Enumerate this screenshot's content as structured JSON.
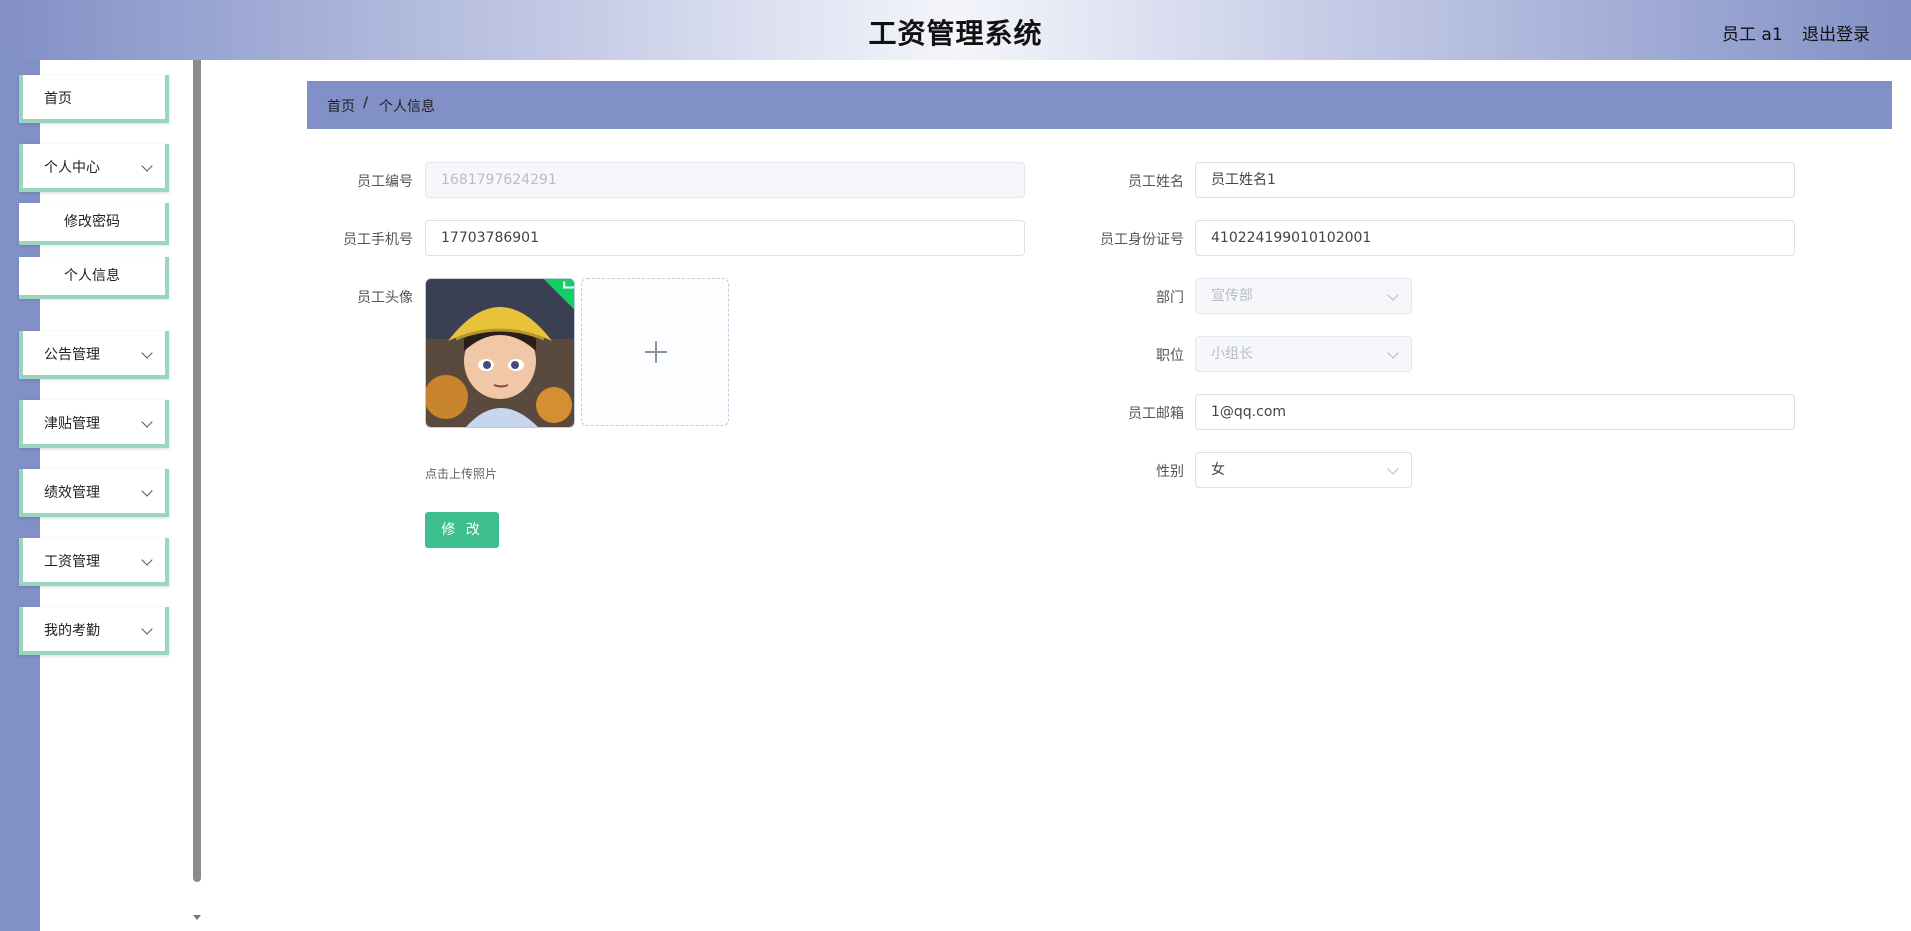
{
  "header": {
    "title": "工资管理系统",
    "user": "员工 a1",
    "logout": "退出登录"
  },
  "sidebar": {
    "items": [
      {
        "label": "首页"
      },
      {
        "label": "个人中心",
        "sub": [
          "修改密码",
          "个人信息"
        ]
      },
      {
        "label": "公告管理"
      },
      {
        "label": "津贴管理"
      },
      {
        "label": "绩效管理"
      },
      {
        "label": "工资管理"
      },
      {
        "label": "我的考勤"
      }
    ]
  },
  "breadcrumb": {
    "home": "首页",
    "separator": "/",
    "current": "个人信息"
  },
  "form": {
    "emp_no": {
      "label": "员工编号",
      "value": "1681797624291"
    },
    "emp_name": {
      "label": "员工姓名",
      "value": "员工姓名1"
    },
    "phone": {
      "label": "员工手机号",
      "value": "17703786901"
    },
    "id_card": {
      "label": "员工身份证号",
      "value": "410224199010102001"
    },
    "avatar": {
      "label": "员工头像",
      "tip": "点击上传照片"
    },
    "department": {
      "label": "部门",
      "value": "宣传部"
    },
    "position": {
      "label": "职位",
      "value": "小组长"
    },
    "email": {
      "label": "员工邮箱",
      "value": "1@qq.com"
    },
    "gender": {
      "label": "性别",
      "value": "女"
    },
    "submit": "修 改"
  },
  "colors": {
    "accent": "#8190c6",
    "menu_border": "#9ad6bd",
    "button": "#3fbf8e",
    "success": "#13ce66"
  }
}
